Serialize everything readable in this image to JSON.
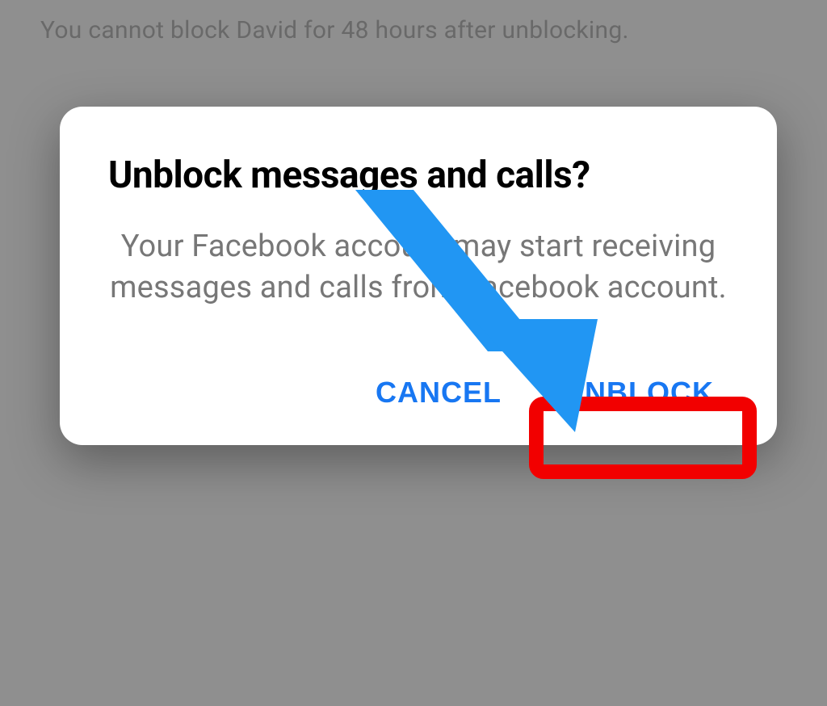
{
  "background": {
    "notice_text": "You cannot block David for 48 hours after unblocking."
  },
  "dialog": {
    "title": "Unblock messages and calls?",
    "body": "Your Facebook account may start receiving messages and calls from Facebook account.",
    "cancel_label": "CANCEL",
    "confirm_label": "UNBLOCK"
  },
  "annotation": {
    "arrow_color": "#2196f3",
    "highlight_color": "#f20000"
  }
}
